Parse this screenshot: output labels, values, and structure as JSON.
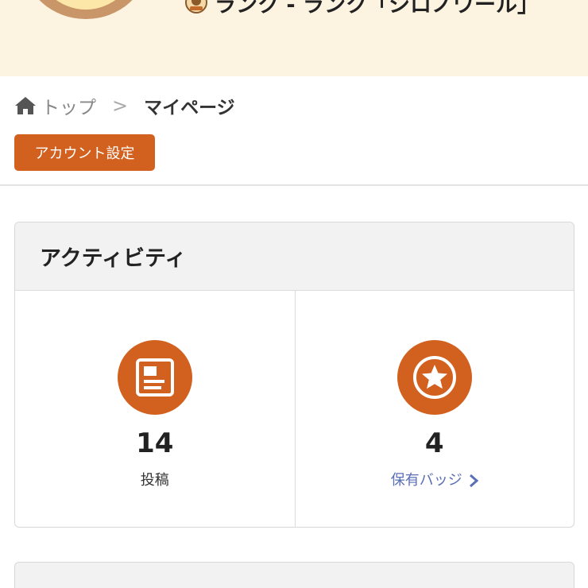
{
  "profile": {
    "rank_text": "ランク - ランク「シロノワール」",
    "rank_emblem_icon": "rank-emblem-icon"
  },
  "breadcrumb": {
    "home_icon": "home-icon",
    "home_label": "トップ",
    "separator": ">",
    "current": "マイページ"
  },
  "account_button": {
    "label": "アカウント設定"
  },
  "activity": {
    "title": "アクティビティ",
    "stats": [
      {
        "icon": "article-icon",
        "value": "14",
        "label": "投稿"
      },
      {
        "icon": "star-badge-icon",
        "value": "4",
        "label": "保有バッジ",
        "link_icon": "chevron-right-icon"
      }
    ]
  },
  "next_card": {
    "title": ""
  },
  "colors": {
    "accent": "#d2601f",
    "header_bg": "#fdf3e1",
    "link": "#5a6fb5",
    "card_header_bg": "#f2f2f2"
  }
}
